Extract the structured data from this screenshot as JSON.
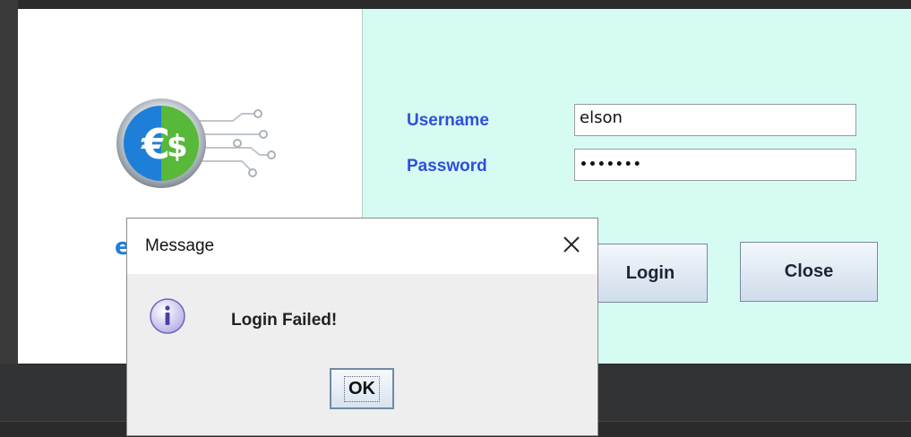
{
  "login": {
    "username_label": "Username",
    "password_label": "Password",
    "username_value": "elson",
    "password_value": "•••••••",
    "login_label": "Login",
    "close_label": "Close"
  },
  "dialog": {
    "title": "Message",
    "message": "Login Failed!",
    "ok_label": "OK",
    "close_glyph": "✕"
  },
  "colors": {
    "label": "#2f4fd9",
    "right_panel": "#d6fbf3",
    "dialog_bg": "#eeeeee"
  },
  "icons": {
    "logo": "euro-dollar-coin-logo",
    "dialog_icon": "info-icon",
    "dialog_close": "close-icon"
  }
}
